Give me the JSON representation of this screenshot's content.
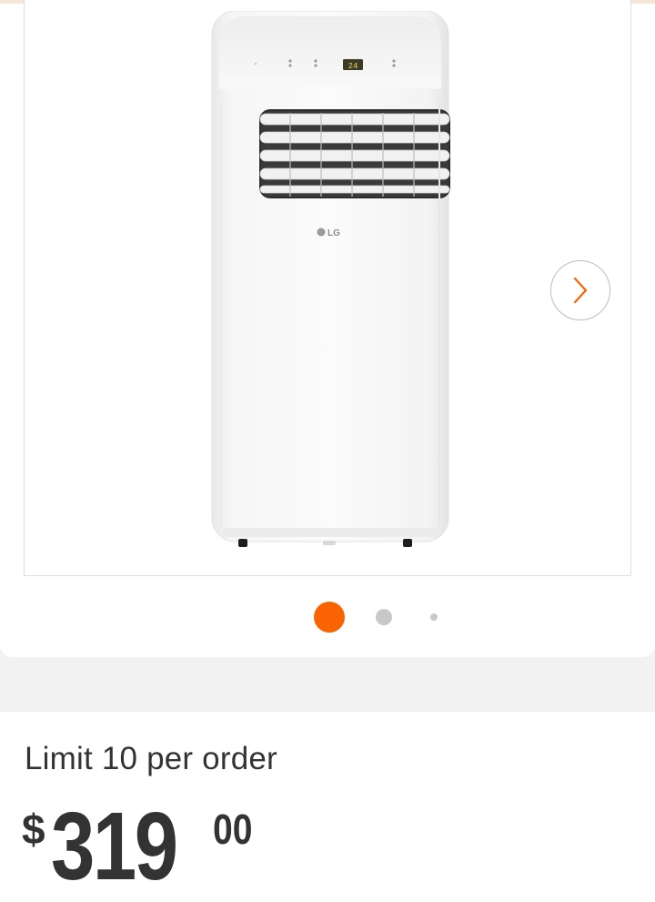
{
  "gallery": {
    "brand_logo": "LG",
    "display_readout": "24",
    "next_icon": "chevron-right-icon",
    "slides": [
      "slide-1",
      "slide-2",
      "slide-3"
    ],
    "active_slide": 1
  },
  "purchase": {
    "limit_text": "Limit 10 per order",
    "price_symbol": "$",
    "price_dollars": "319",
    "price_cents": "00"
  },
  "colors": {
    "accent": "#f96302",
    "inactive_dot": "#c8c8c8",
    "text": "#333333",
    "band": "#f2f2f2"
  }
}
